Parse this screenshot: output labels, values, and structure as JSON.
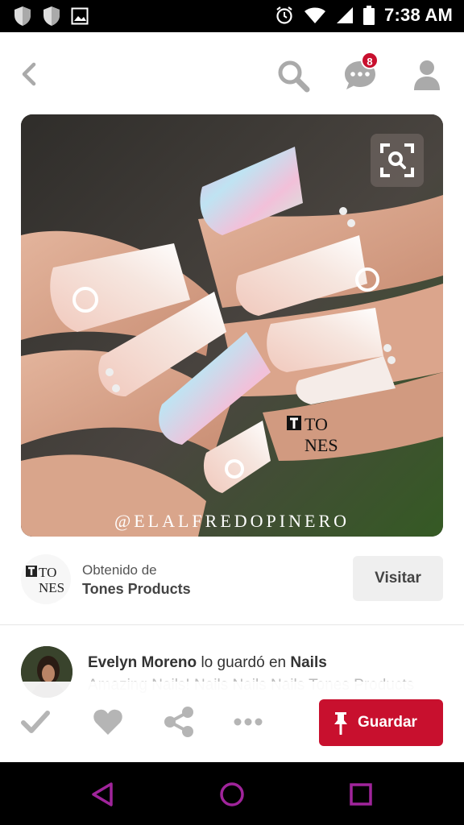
{
  "status_bar": {
    "time": "7:38 AM",
    "left_icons": [
      "shield-icon",
      "shield-icon",
      "image-icon"
    ],
    "right_icons": [
      "alarm-icon",
      "wifi-icon",
      "signal-icon",
      "battery-icon"
    ]
  },
  "top_bar": {
    "back_icon": "chevron-left-icon",
    "search_icon": "search-icon",
    "messages_icon": "chat-bubble-icon",
    "messages_badge": "8",
    "profile_icon": "person-icon"
  },
  "pin": {
    "watermark_handle": "@ELALFREDOPINERO",
    "brand_watermark": "TONES",
    "visual_search_icon": "visual-search-icon"
  },
  "source": {
    "label": "Obtenido de",
    "name": "Tones Products",
    "visit_label": "Visitar"
  },
  "saver": {
    "user": "Evelyn Moreno",
    "verb": "lo guardó en",
    "board": "Nails",
    "description": "Amazing Nails! Nails Nails Nails Tones Products"
  },
  "actions": {
    "done_icon": "check-icon",
    "like_icon": "heart-icon",
    "share_icon": "share-icon",
    "more_icon": "more-dots-icon",
    "save_label": "Guardar",
    "save_icon": "pushpin-icon"
  },
  "nav_bar": {
    "back_icon": "triangle-back-icon",
    "home_icon": "circle-home-icon",
    "recents_icon": "square-recents-icon"
  },
  "colors": {
    "accent": "#c8102e",
    "icon_gray": "#b5b5b5",
    "nav_purple": "#a0249b"
  }
}
